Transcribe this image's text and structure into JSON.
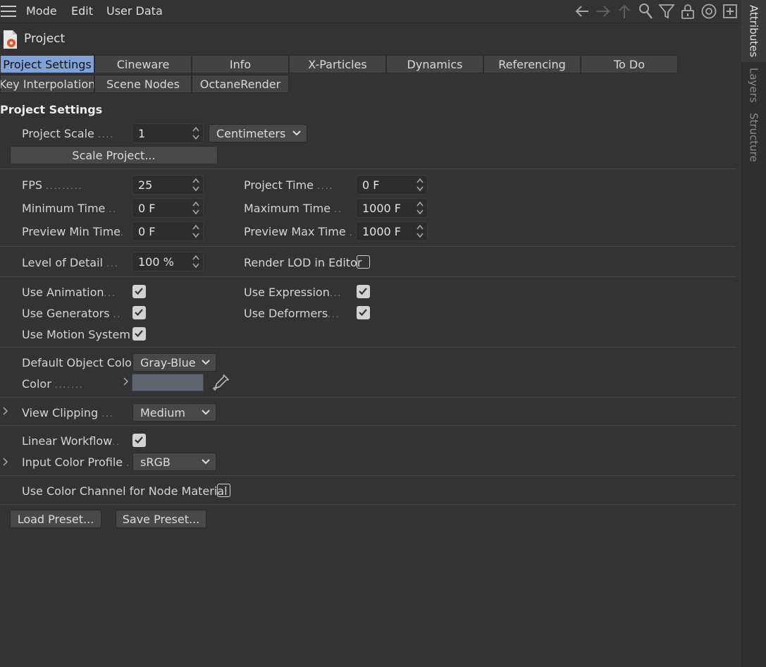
{
  "menubar": {
    "items": [
      "Mode",
      "Edit",
      "User Data"
    ],
    "icons": [
      "back-arrow-icon",
      "forward-arrow-icon",
      "up-arrow-icon",
      "search-icon",
      "filter-icon",
      "lock-icon",
      "target-icon",
      "new-panel-icon"
    ]
  },
  "side_tabs": {
    "attributes": "Attributes",
    "layers": "Layers",
    "structure": "Structure"
  },
  "header": {
    "title": "Project"
  },
  "tabs": {
    "row1": [
      "Project Settings",
      "Cineware",
      "Info",
      "X-Particles",
      "Dynamics",
      "Referencing",
      "To Do"
    ],
    "row2": [
      "Key Interpolation",
      "Scene Nodes",
      "OctaneRender"
    ],
    "active": "Project Settings"
  },
  "section": {
    "title": "Project Settings"
  },
  "fields": {
    "project_scale": {
      "label": "Project Scale",
      "value": "1",
      "unit": "Centimeters"
    },
    "scale_button": "Scale Project...",
    "fps": {
      "label": "FPS",
      "value": "25"
    },
    "project_time": {
      "label": "Project Time",
      "value": "0 F"
    },
    "minimum_time": {
      "label": "Minimum Time",
      "value": "0 F"
    },
    "maximum_time": {
      "label": "Maximum Time",
      "value": "1000 F"
    },
    "preview_min": {
      "label": "Preview Min Time",
      "value": "0 F"
    },
    "preview_max": {
      "label": "Preview Max Time",
      "value": "1000 F"
    },
    "level_of_detail": {
      "label": "Level of Detail",
      "value": "100 %"
    },
    "render_lod": {
      "label": "Render LOD in Editor",
      "checked": false
    },
    "use_animation": {
      "label": "Use Animation",
      "checked": true
    },
    "use_expression": {
      "label": "Use Expression",
      "checked": true
    },
    "use_generators": {
      "label": "Use Generators",
      "checked": true
    },
    "use_deformers": {
      "label": "Use Deformers",
      "checked": true
    },
    "use_motion": {
      "label": "Use Motion System",
      "checked": true
    },
    "default_object_color": {
      "label": "Default Object Color",
      "value": "Gray-Blue"
    },
    "color": {
      "label": "Color",
      "swatch": "#5d6670"
    },
    "view_clipping": {
      "label": "View Clipping",
      "value": "Medium"
    },
    "linear_workflow": {
      "label": "Linear Workflow",
      "checked": true
    },
    "input_color_profile": {
      "label": "Input Color Profile",
      "value": "sRGB"
    },
    "use_color_channel": {
      "label": "Use Color Channel for Node Material",
      "checked": false
    }
  },
  "buttons": {
    "load_preset": "Load Preset...",
    "save_preset": "Save Preset..."
  },
  "colors": {
    "background": "#333333",
    "active_tab": "#7fa3d9",
    "field_bg": "#2d2d2d",
    "button_bg": "#484848"
  }
}
